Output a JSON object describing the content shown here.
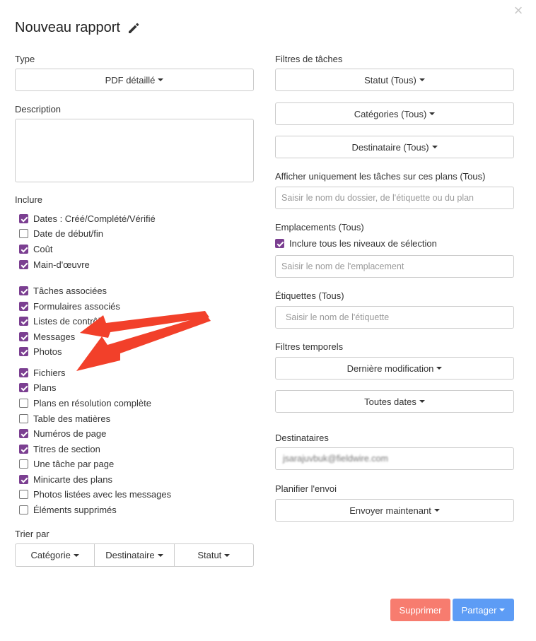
{
  "dialog": {
    "title": "Nouveau rapport",
    "close_glyph": "×"
  },
  "left": {
    "type_label": "Type",
    "type_value": "PDF détaillé",
    "description_label": "Description",
    "include_label": "Inclure",
    "include_items": [
      {
        "label": "Dates : Créé/Complété/Vérifié",
        "checked": true
      },
      {
        "label": "Date de début/fin",
        "checked": false
      },
      {
        "label": "Coût",
        "checked": true
      },
      {
        "label": "Main-d'œuvre",
        "checked": true
      },
      {
        "label": "Tâches associées",
        "checked": true
      },
      {
        "label": "Formulaires associés",
        "checked": true
      },
      {
        "label": "Listes de contrôle",
        "checked": true
      },
      {
        "label": "Messages",
        "checked": true
      },
      {
        "label": "Photos",
        "checked": true
      },
      {
        "label": "Fichiers",
        "checked": true
      },
      {
        "label": "Plans",
        "checked": true
      },
      {
        "label": "Plans en résolution complète",
        "checked": false
      },
      {
        "label": "Table des matières",
        "checked": false
      },
      {
        "label": "Numéros de page",
        "checked": true
      },
      {
        "label": "Titres de section",
        "checked": true
      },
      {
        "label": "Une tâche par page",
        "checked": false
      },
      {
        "label": "Minicarte des plans",
        "checked": true
      },
      {
        "label": "Photos listées avec les messages",
        "checked": false
      },
      {
        "label": "Éléments supprimés",
        "checked": false
      }
    ],
    "sort_label": "Trier par",
    "sort_options": [
      "Catégorie",
      "Destinataire",
      "Statut"
    ]
  },
  "right": {
    "task_filters_label": "Filtres de tâches",
    "status_button": "Statut (Tous)",
    "categories_button": "Catégories (Tous)",
    "assignee_button": "Destinataire (Tous)",
    "plans_label": "Afficher uniquement les tâches sur ces plans (Tous)",
    "plans_placeholder": "Saisir le nom du dossier, de l'étiquette ou du plan",
    "locations_label": "Emplacements (Tous)",
    "include_levels_label": "Inclure tous les niveaux de sélection",
    "include_levels_checked": true,
    "location_placeholder": "Saisir le nom de l'emplacement",
    "tags_label": "Étiquettes (Tous)",
    "tags_placeholder": "Saisir le nom de l'étiquette",
    "time_filters_label": "Filtres temporels",
    "last_modified_button": "Dernière modification",
    "all_dates_button": "Toutes dates",
    "recipients_label": "Destinataires",
    "recipient_value": "jsarajuvbuk@fieldwire.com",
    "schedule_label": "Planifier l'envoi",
    "send_now_button": "Envoyer maintenant"
  },
  "footer": {
    "delete_button": "Supprimer",
    "share_button": "Partager"
  },
  "colors": {
    "checkbox": "#7b3f91",
    "delete": "#f77c6f",
    "share": "#5d9cf5",
    "annotation_arrow": "#f2402a"
  },
  "icons": {
    "edit": "pencil-icon",
    "close": "close-icon"
  }
}
